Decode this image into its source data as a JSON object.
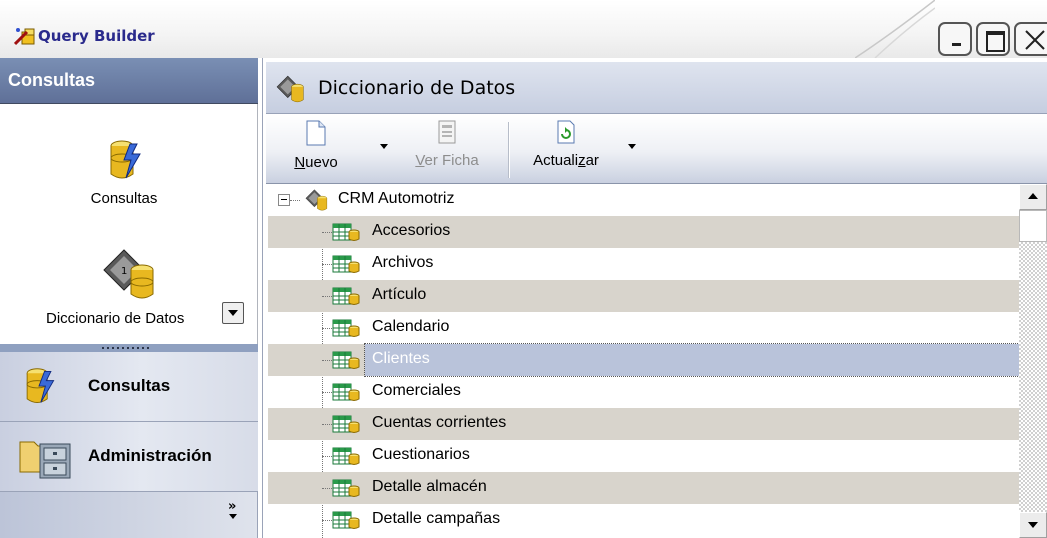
{
  "window": {
    "title": "Query Builder"
  },
  "left_panel": {
    "header": "Consultas",
    "icon_items": [
      {
        "label": "Consultas",
        "icon": "consultas-database-lightning-icon"
      },
      {
        "label": "Diccionario de Datos",
        "icon": "diccionario-book-database-icon"
      }
    ],
    "big_buttons": [
      {
        "label": "Consultas",
        "icon": "consultas-database-lightning-icon"
      },
      {
        "label": "Administración",
        "icon": "administracion-folder-cabinet-icon"
      }
    ],
    "footer_chevron": "»"
  },
  "right_panel": {
    "header": "Diccionario de Datos",
    "toolbar": {
      "nuevo": {
        "label": "Nuevo",
        "mnemonic": "N",
        "rest": "uevo",
        "has_dropdown": true
      },
      "ver_ficha": {
        "label": "Ver Ficha",
        "mnemonic": "V",
        "rest": "er Ficha",
        "enabled": false
      },
      "actualizar": {
        "label": "Actualizar",
        "prefix": "Actuali",
        "mnemonic": "z",
        "rest": "ar",
        "has_dropdown": true
      }
    },
    "tree": {
      "root": "CRM Automotriz",
      "selected": "Clientes",
      "items": [
        "Accesorios",
        "Archivos",
        "Artículo",
        "Calendario",
        "Clientes",
        "Comerciales",
        "Cuentas corrientes",
        "Cuestionarios",
        "Detalle almacén",
        "Detalle campañas"
      ]
    }
  },
  "colors": {
    "left_header_bg": "#6d80a8",
    "selected_row_bg": "#b9c3da",
    "alt_row_bg": "#d8d4cc",
    "title_text": "#2a2a8c"
  }
}
